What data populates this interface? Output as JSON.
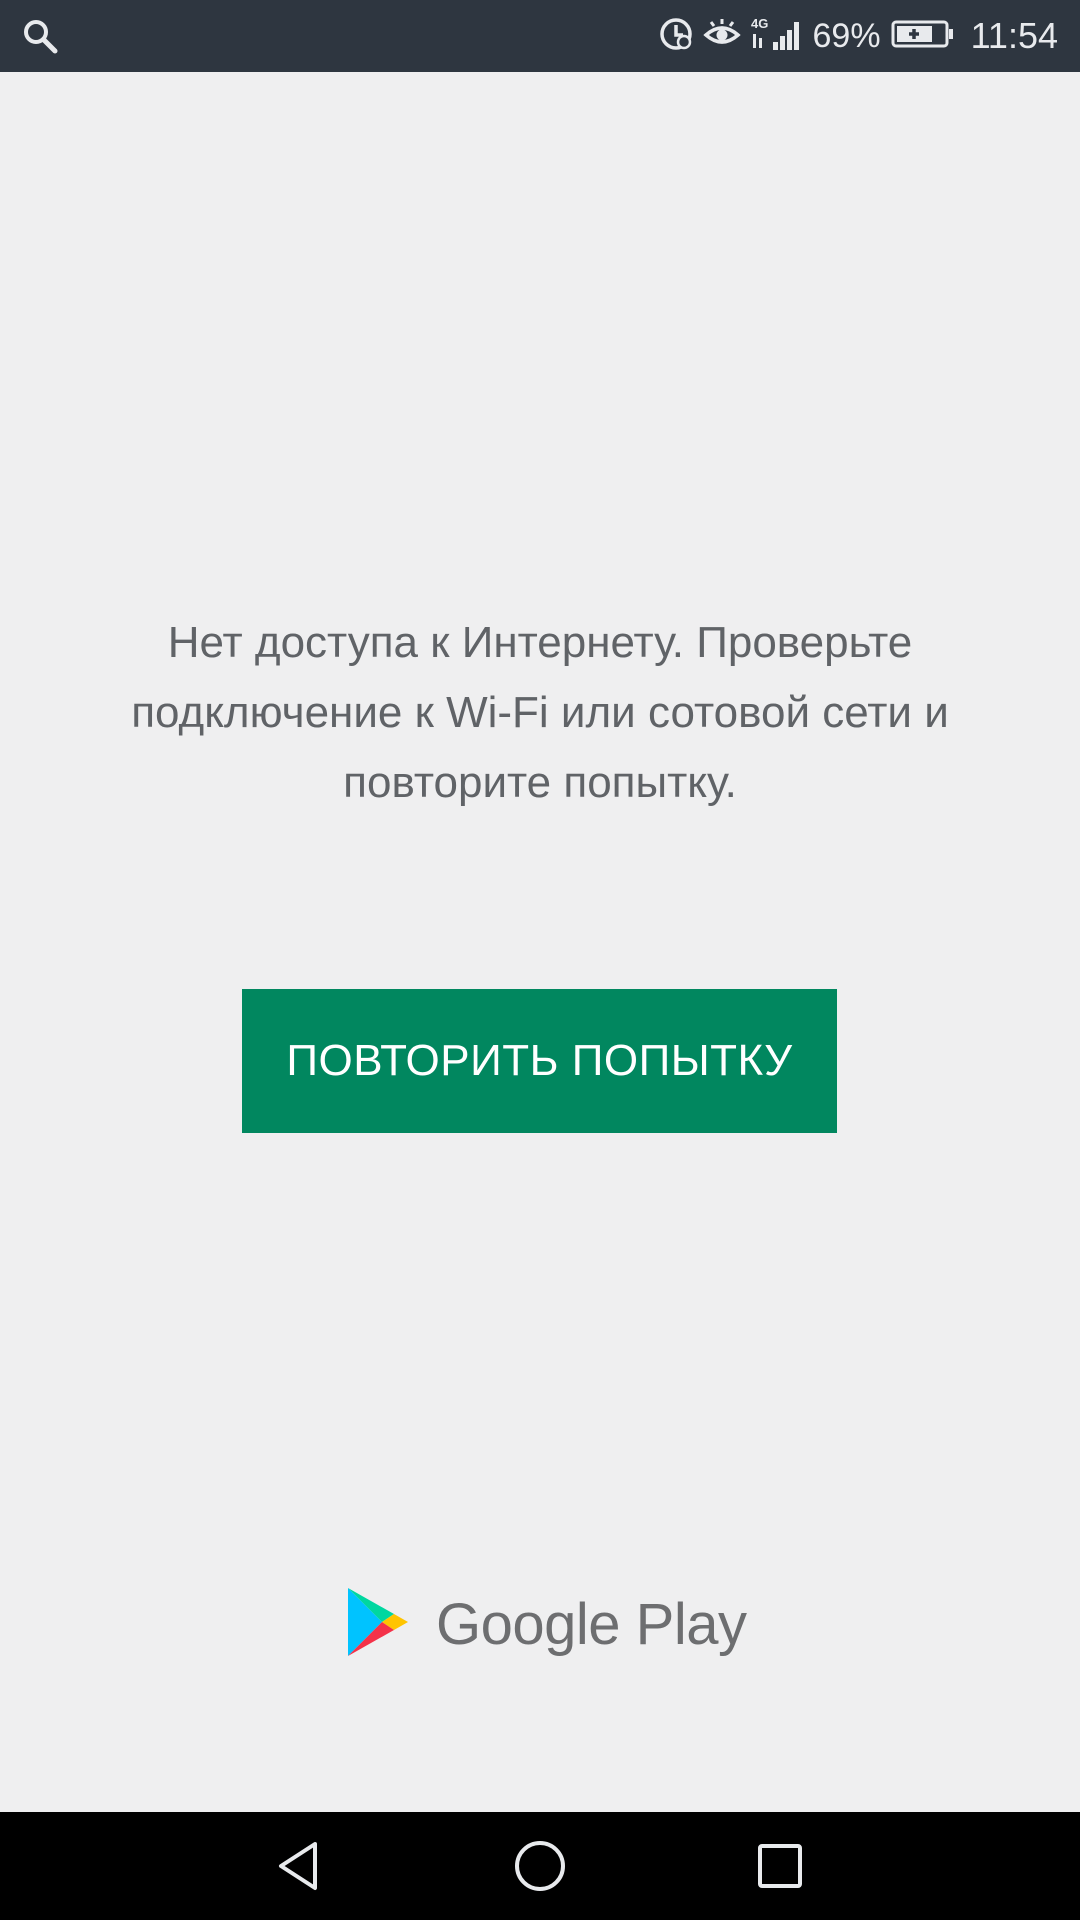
{
  "status_bar": {
    "battery_percent": "69%",
    "time": "11:54",
    "network_label": "4G",
    "icons": [
      "search-icon",
      "data-saver-icon",
      "eye-comfort-icon",
      "signal-icon",
      "battery-charging-icon"
    ]
  },
  "main": {
    "message": "Нет доступа к Интернету. Проверьте подключение к Wi-Fi или сотовой сети и повторите попытку.",
    "retry_label": "ПОВТОРИТЬ ПОПЫТКУ"
  },
  "branding": {
    "logo_text": "Google Play"
  },
  "nav_bar": {
    "icons": [
      "back-icon",
      "home-icon",
      "recents-icon"
    ]
  },
  "colors": {
    "status_bar": "#2e3640",
    "background": "#efeff0",
    "accent": "#01875f",
    "text": "#606367",
    "nav_bar": "#000000"
  }
}
